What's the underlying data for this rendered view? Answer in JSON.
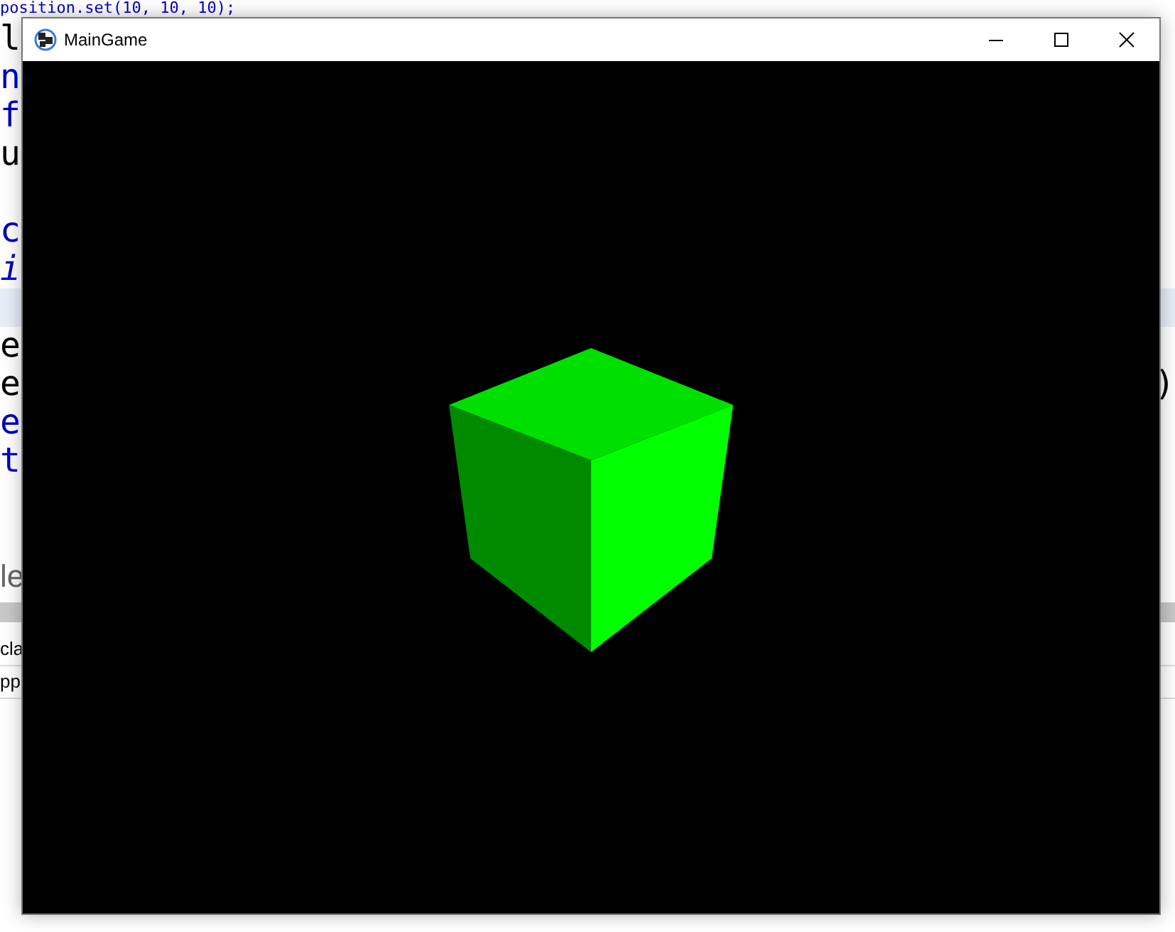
{
  "editor": {
    "lines": [
      {
        "kind": "top",
        "left": "position.set(10, 10, 10);"
      },
      {
        "kind": "plain",
        "left": "l"
      },
      {
        "kind": "keyword",
        "left": "n"
      },
      {
        "kind": "keyword",
        "left": "f"
      },
      {
        "kind": "plain",
        "left": "u"
      },
      {
        "kind": "plain"
      },
      {
        "kind": "keyword",
        "left": "c"
      },
      {
        "kind": "italic",
        "left": "i"
      },
      {
        "kind": "current"
      },
      {
        "kind": "plain",
        "left": "e"
      },
      {
        "kind": "plain",
        "left": "e",
        "right": ")"
      },
      {
        "kind": "keyword",
        "left": "e"
      },
      {
        "kind": "keyword",
        "left": "t"
      },
      {
        "kind": "plain"
      },
      {
        "kind": "plain"
      },
      {
        "kind": "dim",
        "left": "le"
      }
    ]
  },
  "panel": {
    "lines": [
      "cla",
      "pp"
    ]
  },
  "window": {
    "title": "MainGame"
  }
}
